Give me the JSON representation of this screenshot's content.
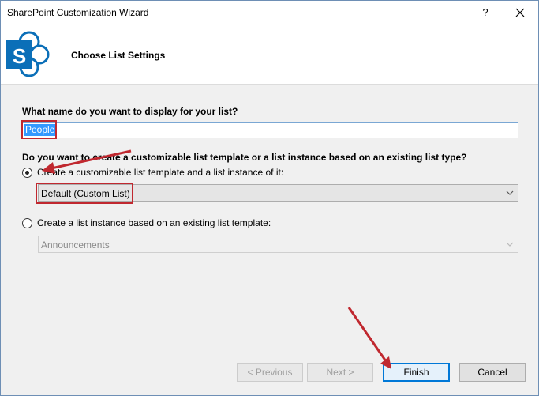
{
  "window": {
    "title": "SharePoint Customization Wizard",
    "help_label": "?",
    "logo_letter": "S"
  },
  "header": {
    "title": "Choose List Settings"
  },
  "form": {
    "name_question": "What name do you want to display for your list?",
    "name_value": "People",
    "type_question": "Do you want to create a customizable list template or a list instance based on an existing list type?",
    "option1_label": "Create a customizable list template and a list instance of it:",
    "option1_selected": true,
    "option1_value": "Default (Custom List)",
    "option2_label": "Create a list instance based on an existing list template:",
    "option2_selected": false,
    "option2_value": "Announcements"
  },
  "buttons": {
    "previous": "< Previous",
    "next": "Next >",
    "finish": "Finish",
    "cancel": "Cancel"
  },
  "colors": {
    "annotation_red": "#c0282f",
    "sharepoint_blue": "#0b6fb8",
    "focus_blue": "#0078d7"
  }
}
